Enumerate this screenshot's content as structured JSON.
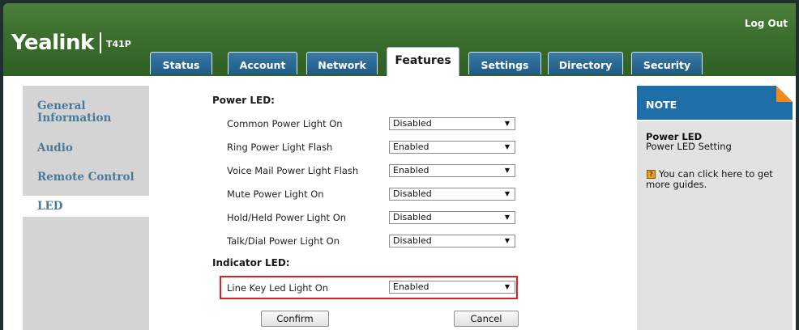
{
  "header": {
    "brand": "Yealink",
    "model": "T41P",
    "logout_label": "Log Out"
  },
  "tabs": [
    {
      "label": "Status"
    },
    {
      "label": "Account"
    },
    {
      "label": "Network"
    },
    {
      "label": "Features",
      "active": true
    },
    {
      "label": "Settings"
    },
    {
      "label": "Directory"
    },
    {
      "label": "Security"
    }
  ],
  "sidebar": {
    "items": [
      {
        "label": "General\nInformation"
      },
      {
        "label": "Audio"
      },
      {
        "label": "Remote Control"
      },
      {
        "label": "LED",
        "active": true
      }
    ]
  },
  "form": {
    "power_led_title": "Power LED:",
    "indicator_led_title": "Indicator LED:",
    "rows": [
      {
        "label": "Common Power Light On",
        "value": "Disabled"
      },
      {
        "label": "Ring Power Light Flash",
        "value": "Enabled"
      },
      {
        "label": "Voice Mail Power Light Flash",
        "value": "Enabled"
      },
      {
        "label": "Mute Power Light On",
        "value": "Disabled"
      },
      {
        "label": "Hold/Held Power Light On",
        "value": "Disabled"
      },
      {
        "label": "Talk/Dial Power Light On",
        "value": "Disabled"
      },
      {
        "label": "Line Key Led Light On",
        "value": "Enabled"
      }
    ],
    "confirm_label": "Confirm",
    "cancel_label": "Cancel"
  },
  "note": {
    "heading": "NOTE",
    "title": "Power LED",
    "subtitle": "Power LED Setting",
    "guide_text": "You can click here to get more guides.",
    "guide_icon_glyph": "?"
  },
  "colors": {
    "header_green": "#3b6e2d",
    "tab_blue": "#1f5a86",
    "note_blue": "#1e6ea8",
    "sidebar_link": "#4a7a9a",
    "highlight_red": "#e02020",
    "accent_orange": "#f08c1e"
  }
}
